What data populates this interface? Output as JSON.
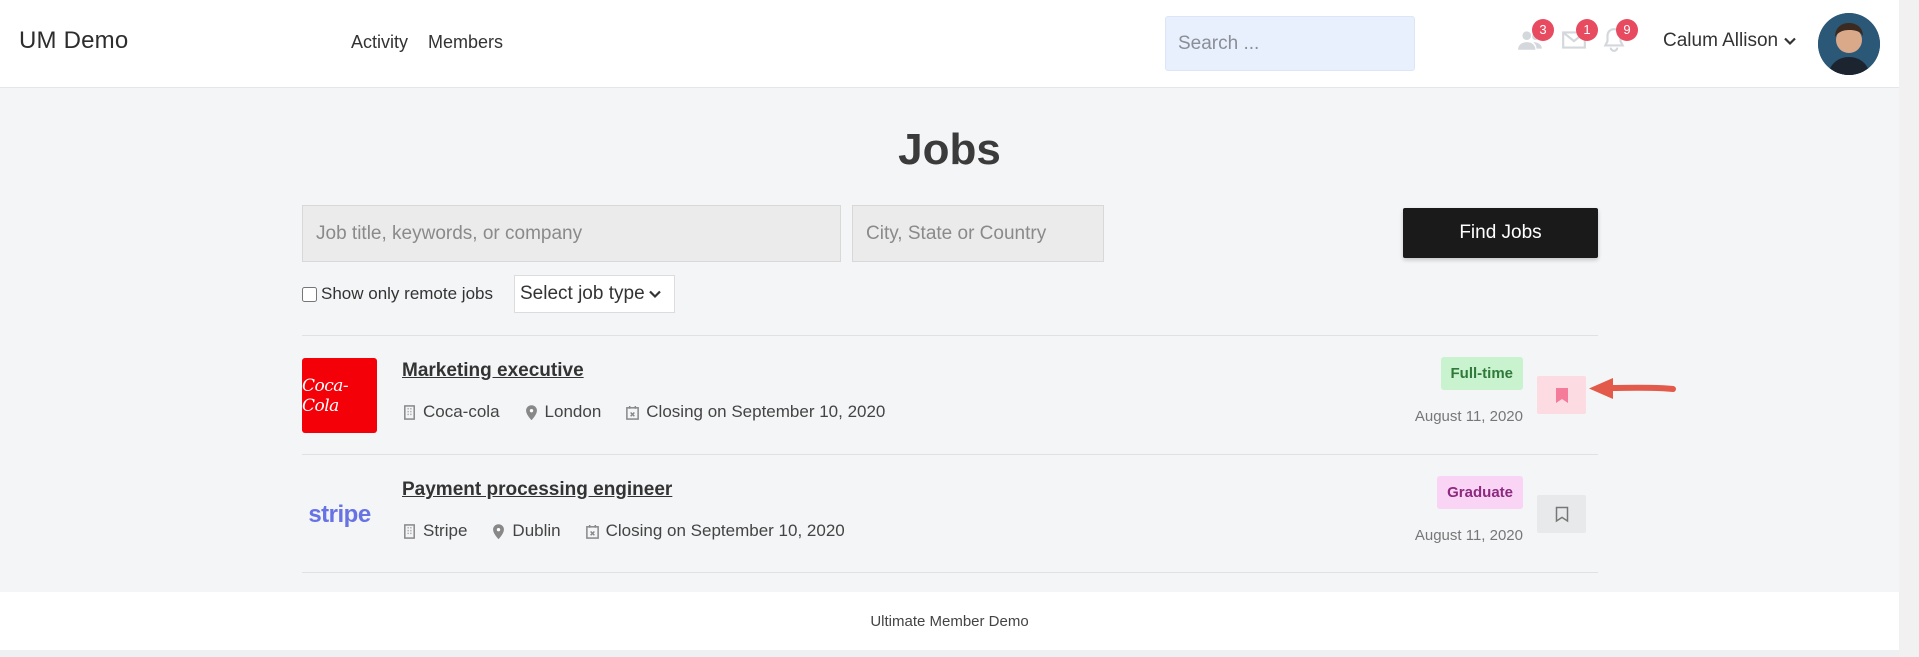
{
  "header": {
    "brand": "UM Demo",
    "nav": [
      {
        "label": "Activity"
      },
      {
        "label": "Members"
      }
    ],
    "search_placeholder": "Search ...",
    "badges": {
      "friends": "3",
      "messages": "1",
      "notifications": "9"
    },
    "user_name": "Calum Allison"
  },
  "page": {
    "title": "Jobs",
    "keyword_placeholder": "Job title, keywords, or company",
    "location_placeholder": "City, State or Country",
    "find_button": "Find Jobs",
    "remote_label": "Show only remote jobs",
    "job_type_select": "Select job type"
  },
  "jobs": [
    {
      "logo_text": "Coca-Cola",
      "title": "Marketing executive",
      "company": "Coca-cola",
      "location": "London",
      "closing": "Closing on September 10, 2020",
      "type": "Full-time",
      "type_bg": "#c9f2cf",
      "type_color": "#2f7a3a",
      "date": "August 11, 2020",
      "bookmarked": true
    },
    {
      "logo_text": "stripe",
      "title": "Payment processing engineer",
      "company": "Stripe",
      "location": "Dublin",
      "closing": "Closing on September 10, 2020",
      "type": "Graduate",
      "type_bg": "#f9d4f4",
      "type_color": "#8d2a7f",
      "date": "August 11, 2020",
      "bookmarked": false
    }
  ],
  "footer": {
    "text": "Ultimate Member Demo"
  },
  "colors": {
    "accent_dark": "#1a1a1a",
    "badge": "#e84a5f",
    "bookmark_active": "#f47b99",
    "annotation_arrow": "#e45a4a"
  }
}
